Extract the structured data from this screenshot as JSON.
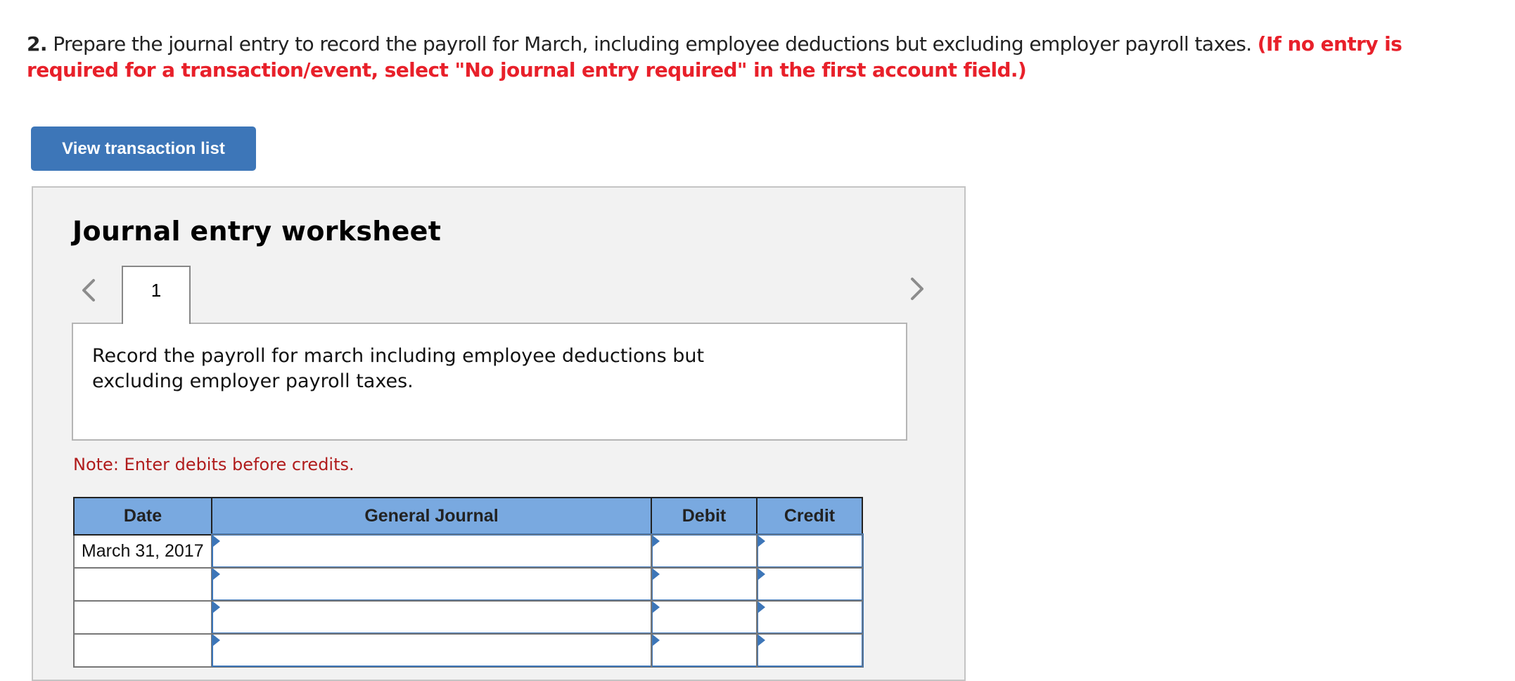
{
  "question": {
    "number": "2.",
    "text": " Prepare the journal entry to record the payroll for March, including employee deductions but excluding employer payroll taxes. ",
    "instruction": "(If no entry is required for a transaction/event, select \"No journal entry required\" in the first account field.)"
  },
  "view_transaction_button": "View transaction list",
  "worksheet": {
    "title": "Journal entry worksheet",
    "prev_icon": "chevron-left-icon",
    "next_icon": "chevron-right-icon",
    "tabs": [
      {
        "label": "1"
      }
    ],
    "description": "Record the payroll for march including employee deductions but excluding employer payroll taxes.",
    "note": "Note: Enter debits before credits.",
    "table": {
      "headers": [
        "Date",
        "General Journal",
        "Debit",
        "Credit"
      ],
      "rows": [
        {
          "date": "March 31, 2017",
          "account": "",
          "debit": "",
          "credit": ""
        },
        {
          "date": "",
          "account": "",
          "debit": "",
          "credit": ""
        },
        {
          "date": "",
          "account": "",
          "debit": "",
          "credit": ""
        },
        {
          "date": "",
          "account": "",
          "debit": "",
          "credit": ""
        }
      ]
    }
  },
  "colors": {
    "instruction_red": "#e8202a",
    "button_blue": "#3d76b8",
    "header_blue": "#79a9e0",
    "note_red": "#b01c1c"
  }
}
